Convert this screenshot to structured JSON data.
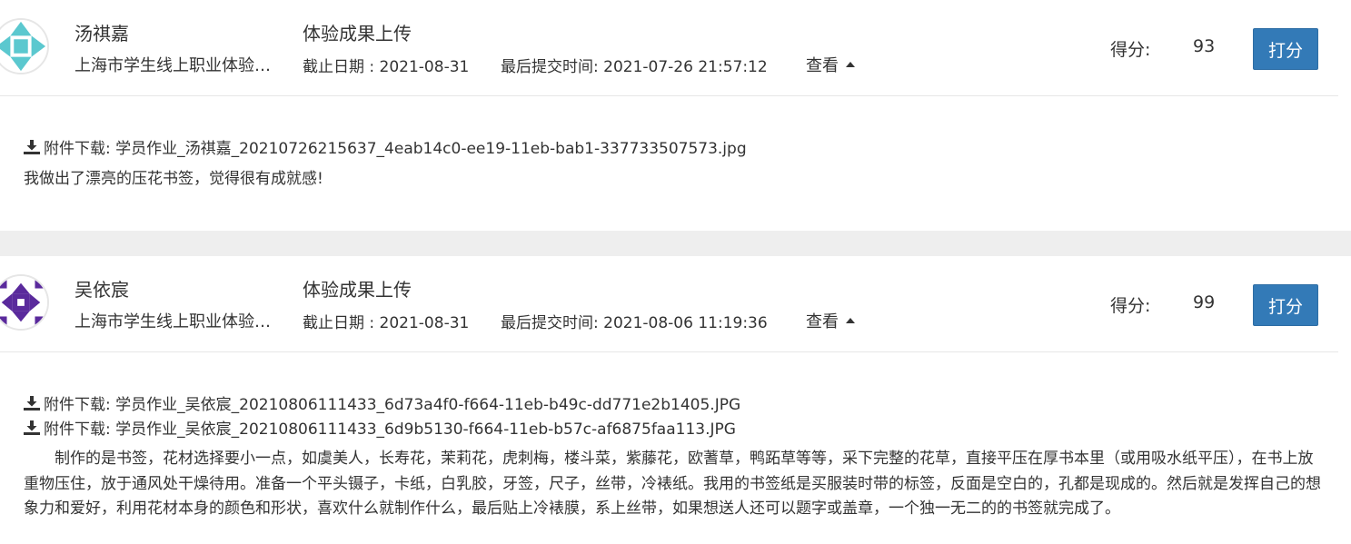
{
  "labels": {
    "score": "得分:",
    "grade_button": "打分",
    "view_toggle": "查看"
  },
  "colors": {
    "primary_button": "#337ab7",
    "avatar_1": "#5bc8cf",
    "avatar_2": "#5a2a9c",
    "separator_band": "#eeeeee"
  },
  "icons": {
    "download": "download-icon",
    "view_toggle_caret": "caret-up-icon"
  },
  "submissions": [
    {
      "student_name": "汤祺嘉",
      "organization": "上海市学生线上职业体验中心",
      "task_title": "体验成果上传",
      "deadline": "截止日期 : 2021-08-31",
      "last_submitted": "最后提交时间:  2021-07-26 21:57:12",
      "score": "93",
      "attachments": [
        "附件下载: 学员作业_汤祺嘉_20210726215637_4eab14c0-ee19-11eb-bab1-337733507573.jpg"
      ],
      "comment": "我做出了漂亮的压花书签，觉得很有成就感!"
    },
    {
      "student_name": "吴依宸",
      "organization": "上海市学生线上职业体验中心",
      "task_title": "体验成果上传",
      "deadline": "截止日期 : 2021-08-31",
      "last_submitted": "最后提交时间:  2021-08-06 11:19:36",
      "score": "99",
      "attachments": [
        "附件下载: 学员作业_吴依宸_20210806111433_6d73a4f0-f664-11eb-b49c-dd771e2b1405.JPG",
        "附件下载: 学员作业_吴依宸_20210806111433_6d9b5130-f664-11eb-b57c-af6875faa113.JPG"
      ],
      "comment": "制作的是书签，花材选择要小一点，如虞美人，长寿花，茉莉花，虎刺梅，楼斗菜，紫藤花，欧蓍草，鸭跖草等等，采下完整的花草，直接平压在厚书本里（或用吸水纸平压），在书上放重物压住，放于通风处干燥待用。准备一个平头镊子，卡纸，白乳胶，牙签，尺子，丝带，冷裱纸。我用的书签纸是买服装时带的标签，反面是空白的，孔都是现成的。然后就是发挥自己的想象力和爱好，利用花材本身的颜色和形状，喜欢什么就制作什么，最后贴上冷裱膜，系上丝带，如果想送人还可以题字或盖章，一个独一无二的的书签就完成了。"
    }
  ]
}
